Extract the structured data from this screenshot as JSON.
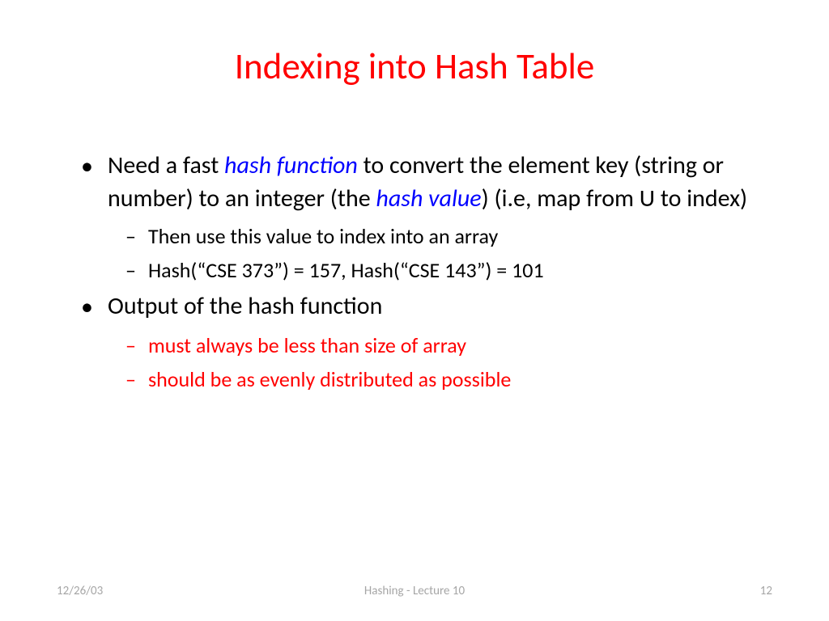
{
  "title": "Indexing into Hash Table",
  "bullets": {
    "b1_pre": "Need a fast ",
    "b1_term1": "hash function",
    "b1_mid": " to convert the element key (string or number) to an integer (the ",
    "b1_term2": "hash value",
    "b1_post": ")  (i.e, map from U to index)",
    "b1_sub1": "Then use this value to index into an array",
    "b1_sub2": "Hash(“CSE 373”) = 157, Hash(“CSE 143”) = 101",
    "b2": "Output of the hash function",
    "b2_sub1": "must always be less than size of array",
    "b2_sub2": "should be as evenly distributed as possible"
  },
  "footer": {
    "date": "12/26/03",
    "center": "Hashing - Lecture 10",
    "page": "12"
  }
}
